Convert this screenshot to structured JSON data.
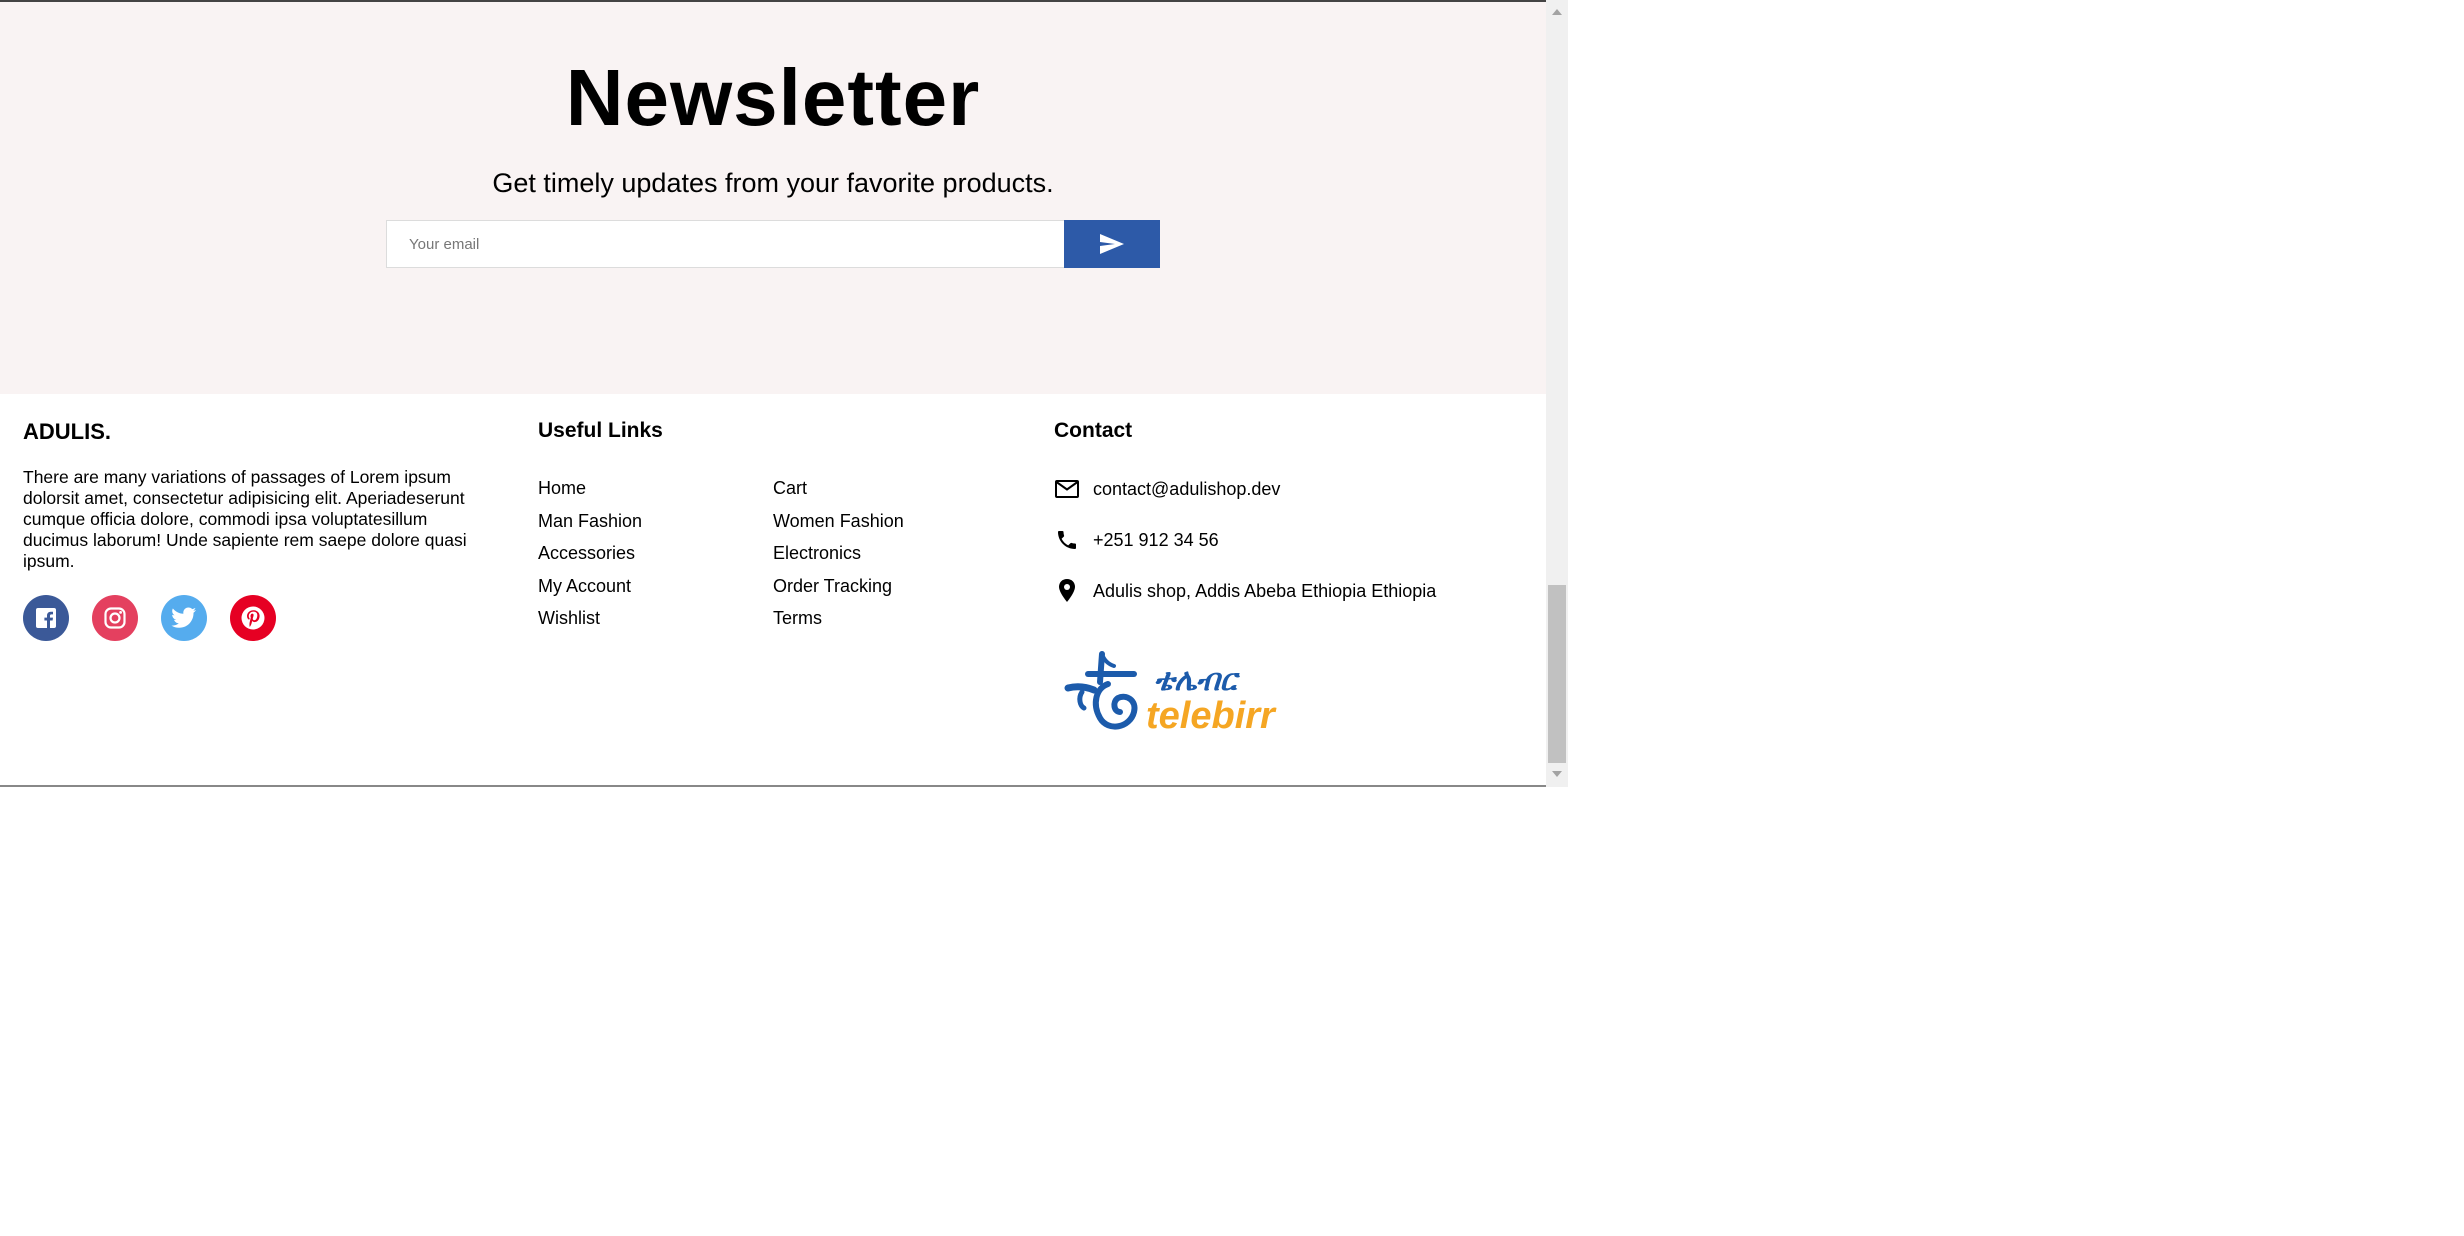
{
  "newsletter": {
    "title": "Newsletter",
    "subtitle": "Get timely updates from your favorite products.",
    "email_placeholder": "Your email",
    "submit_icon": "send-icon",
    "button_color": "#2d5aa8",
    "background": "#f9f3f3"
  },
  "footer": {
    "brand": "ADULIS.",
    "description": "There are many variations of passages of Lorem ipsum dolorsit amet, consectetur adipisicing elit. Aperiadeserunt cumque officia dolore, commodi ipsa voluptatesillum ducimus laborum! Unde sapiente rem saepe dolore quasi ipsum.",
    "socials": [
      {
        "name": "facebook-icon",
        "color": "#3b5998"
      },
      {
        "name": "instagram-icon",
        "color": "#e4405f"
      },
      {
        "name": "twitter-icon",
        "color": "#55acee"
      },
      {
        "name": "pinterest-icon",
        "color": "#e60023"
      }
    ],
    "useful_links": {
      "title": "Useful Links",
      "column_a": [
        "Home",
        "Man Fashion",
        "Accessories",
        "My Account",
        "Wishlist"
      ],
      "column_b": [
        "Cart",
        "Women Fashion",
        "Electronics",
        "Order Tracking",
        "Terms"
      ]
    },
    "contact": {
      "title": "Contact",
      "email": "contact@adulishop.dev",
      "phone": "+251 912 34 56",
      "address": "Adulis shop, Addis Abeba Ethiopia Ethiopia",
      "email_icon": "mail-icon",
      "phone_icon": "phone-icon",
      "address_icon": "location-pin-icon"
    },
    "payment": {
      "name": "telebirr",
      "amharic": "ቴሌብር",
      "blue": "#1c5bab",
      "orange": "#f5a623"
    }
  }
}
